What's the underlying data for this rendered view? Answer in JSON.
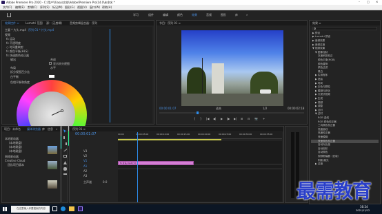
{
  "window": {
    "title": "Adobe Premiere Pro 2020 - C:\\用户\\Xiaoy\\文档\\Adobe\\Premiere Pro\\14.0\\未命名 *",
    "controls": [
      "–",
      "□",
      "✕"
    ]
  },
  "menu": [
    "文件(F)",
    "编辑(E)",
    "剪辑(C)",
    "序列(S)",
    "标记(M)",
    "图形(G)",
    "视图(V)",
    "窗口(W)",
    "帮助(H)"
  ],
  "workspaces": [
    "学习",
    "组件",
    "编辑",
    "颜色",
    "效果",
    "音频",
    "图形",
    "库",
    "»"
  ],
  "effect_controls": {
    "tabs": [
      "效果控件 ≡",
      "Lumetri 范围",
      "源：(无剪辑)",
      "音频剪辑混合器：序列"
    ],
    "source_line": "主要 * 片头.mp4",
    "seq_line": "序列 01 * 片头.mp4",
    "rows": [
      "视频",
      "fx 运动",
      "fx 不透明度",
      "○ 时间重映射",
      "fx 颜色平衡(HLS)",
      "fx 快速颜色校正器"
    ],
    "output_label": "输出",
    "output_value": "合成",
    "show_split": "显示拆分视图",
    "layout_label": "布局",
    "layout_value": "水平",
    "split_pct": "拆分视图百分比",
    "white_balance": "白平衡",
    "hue_balance": "色相平衡和角度",
    "gray_label": "色调范围定义",
    "angle_label": "平衡数量级"
  },
  "program_monitor": {
    "tab": "节目：序列 01 ≡",
    "timecode_left": "00:00:01:07",
    "fit": "适合",
    "quality": "1/2",
    "timecode_right": "00:00:02:18",
    "transport": [
      "{",
      "}",
      "|◀",
      "◀|",
      "▶",
      "|▶",
      "▶|",
      "⊞",
      "⊟",
      "📷",
      "+"
    ]
  },
  "effects_panel": {
    "tab": "效果 ≡",
    "items": [
      {
        "label": "▶ 预设",
        "depth": 0
      },
      {
        "label": "▶ Lumetri 预设",
        "depth": 0
      },
      {
        "label": "▶ 音频效果",
        "depth": 0
      },
      {
        "label": "▶ 音频过渡",
        "depth": 0
      },
      {
        "label": "▼ 视频效果",
        "depth": 0
      },
      {
        "label": "▼ 图像控制",
        "depth": 1
      },
      {
        "label": "灰度系数校正",
        "depth": 2
      },
      {
        "label": "颜色平衡(RGB)",
        "depth": 2
      },
      {
        "label": "颜色替换",
        "depth": 2
      },
      {
        "label": "颜色过滤",
        "depth": 2
      },
      {
        "label": "黑白",
        "depth": 2
      },
      {
        "label": "▶ 实用程序",
        "depth": 1
      },
      {
        "label": "▶ 扭曲",
        "depth": 1
      },
      {
        "label": "▶ 时间",
        "depth": 1
      },
      {
        "label": "▶ 杂色与颗粒",
        "depth": 1
      },
      {
        "label": "▶ 模糊与锐化",
        "depth": 1
      },
      {
        "label": "▶ 沉浸式视频",
        "depth": 1
      },
      {
        "label": "▶ 生成",
        "depth": 1
      },
      {
        "label": "▶ 视频",
        "depth": 1
      },
      {
        "label": "▶ 调整",
        "depth": 1
      },
      {
        "label": "▶ 过时",
        "depth": 1
      },
      {
        "label": "▼ 过时",
        "depth": 1
      },
      {
        "label": "RGB 曲线",
        "depth": 2
      },
      {
        "label": "RGB 颜色校正器",
        "depth": 2
      },
      {
        "label": "三向颜色校正器",
        "depth": 2
      },
      {
        "label": "亮度曲线",
        "depth": 2
      },
      {
        "label": "亮度校正器",
        "depth": 2
      },
      {
        "label": "快速模糊",
        "depth": 2
      },
      {
        "label": "快速颜色校正器",
        "depth": 2,
        "selected": true
      },
      {
        "label": "自动对比度",
        "depth": 2
      },
      {
        "label": "自动色阶",
        "depth": 2
      },
      {
        "label": "自动颜色",
        "depth": 2
      },
      {
        "label": "视频限幅器（旧版）",
        "depth": 2
      },
      {
        "label": "阴影/高光",
        "depth": 2
      },
      {
        "label": "▶ 过渡",
        "depth": 1
      }
    ]
  },
  "project_panel": {
    "tabs": [
      "项目：未命名",
      "媒体浏览器",
      "库",
      "信息",
      "»"
    ],
    "items": [
      "本地驱动器",
      "(本地磁盘)",
      "(本地磁盘)",
      "(本地磁盘)",
      "网络驱动器",
      "Creative Cloud",
      "团队项目版本"
    ]
  },
  "timeline": {
    "tab": "序列 01 ≡",
    "timecode": "00:00:01:07",
    "ruler": [
      "00:00",
      "00:00:05:00",
      "00:00:10:00",
      "00:00:15:00",
      "00:00:20:00",
      "00:00:25:00",
      "00:00:30:00",
      "00:00:35:00"
    ],
    "tracks": [
      "V3",
      "V2",
      "V1",
      "A1",
      "A2",
      "A3"
    ],
    "clip_label": "fx 片头.mp4 [V]",
    "master": "主声道",
    "master_value": "0.0"
  },
  "taskbar": {
    "search_placeholder": "在这里输入你要搜索的内容",
    "time": "16:24",
    "date": "2021/11/12",
    "watermark": "最需教育"
  },
  "colors": {
    "accent": "#2d8ceb",
    "clip": "#d57fd5",
    "watermark": "#2a3fc9"
  }
}
